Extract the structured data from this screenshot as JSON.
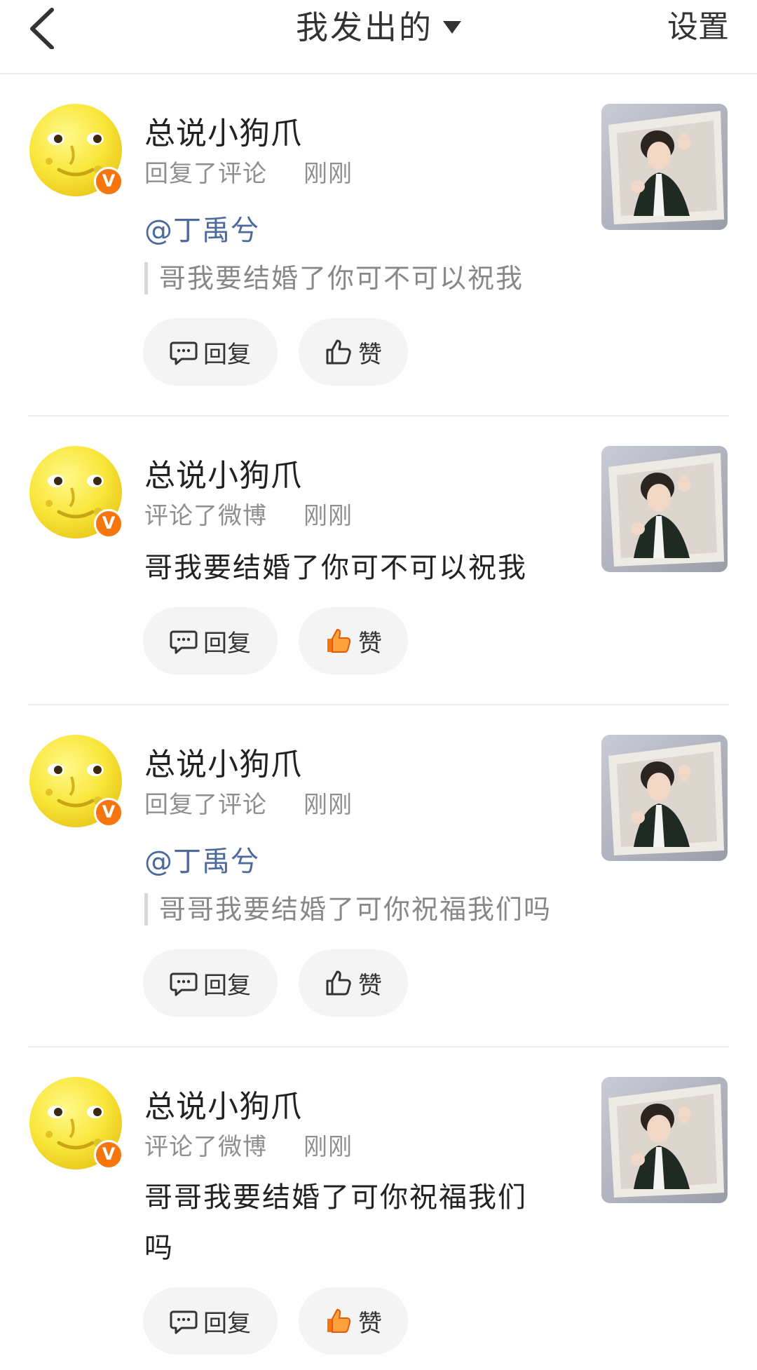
{
  "header": {
    "back_icon": "chevron-left-icon",
    "title": "我发出的",
    "dropdown_icon": "caret-down-icon",
    "settings_label": "设置"
  },
  "colors": {
    "accent_link": "#4c6a9e",
    "verified_badge": "#f7750d",
    "liked_thumb": "#f7750d",
    "button_bg": "#f4f4f4"
  },
  "items": [
    {
      "user_name": "总说小狗爪",
      "verified_badge": "V",
      "action": "回复了评论",
      "time": "刚刚",
      "mention": "@丁禹兮",
      "quote": "哥我要结婚了你可不可以祝我",
      "reply_label": "回复",
      "like_label": "赞",
      "liked": false
    },
    {
      "user_name": "总说小狗爪",
      "verified_badge": "V",
      "action": "评论了微博",
      "time": "刚刚",
      "content_line1": "哥我要结婚了你可不可以祝我",
      "reply_label": "回复",
      "like_label": "赞",
      "liked": true
    },
    {
      "user_name": "总说小狗爪",
      "verified_badge": "V",
      "action": "回复了评论",
      "time": "刚刚",
      "mention": "@丁禹兮",
      "quote": "哥哥我要结婚了可你祝福我们吗",
      "reply_label": "回复",
      "like_label": "赞",
      "liked": false
    },
    {
      "user_name": "总说小狗爪",
      "verified_badge": "V",
      "action": "评论了微博",
      "time": "刚刚",
      "content_line1": "哥哥我要结婚了可你祝福我们",
      "content_line2": "吗",
      "reply_label": "回复",
      "like_label": "赞",
      "liked": true
    }
  ]
}
